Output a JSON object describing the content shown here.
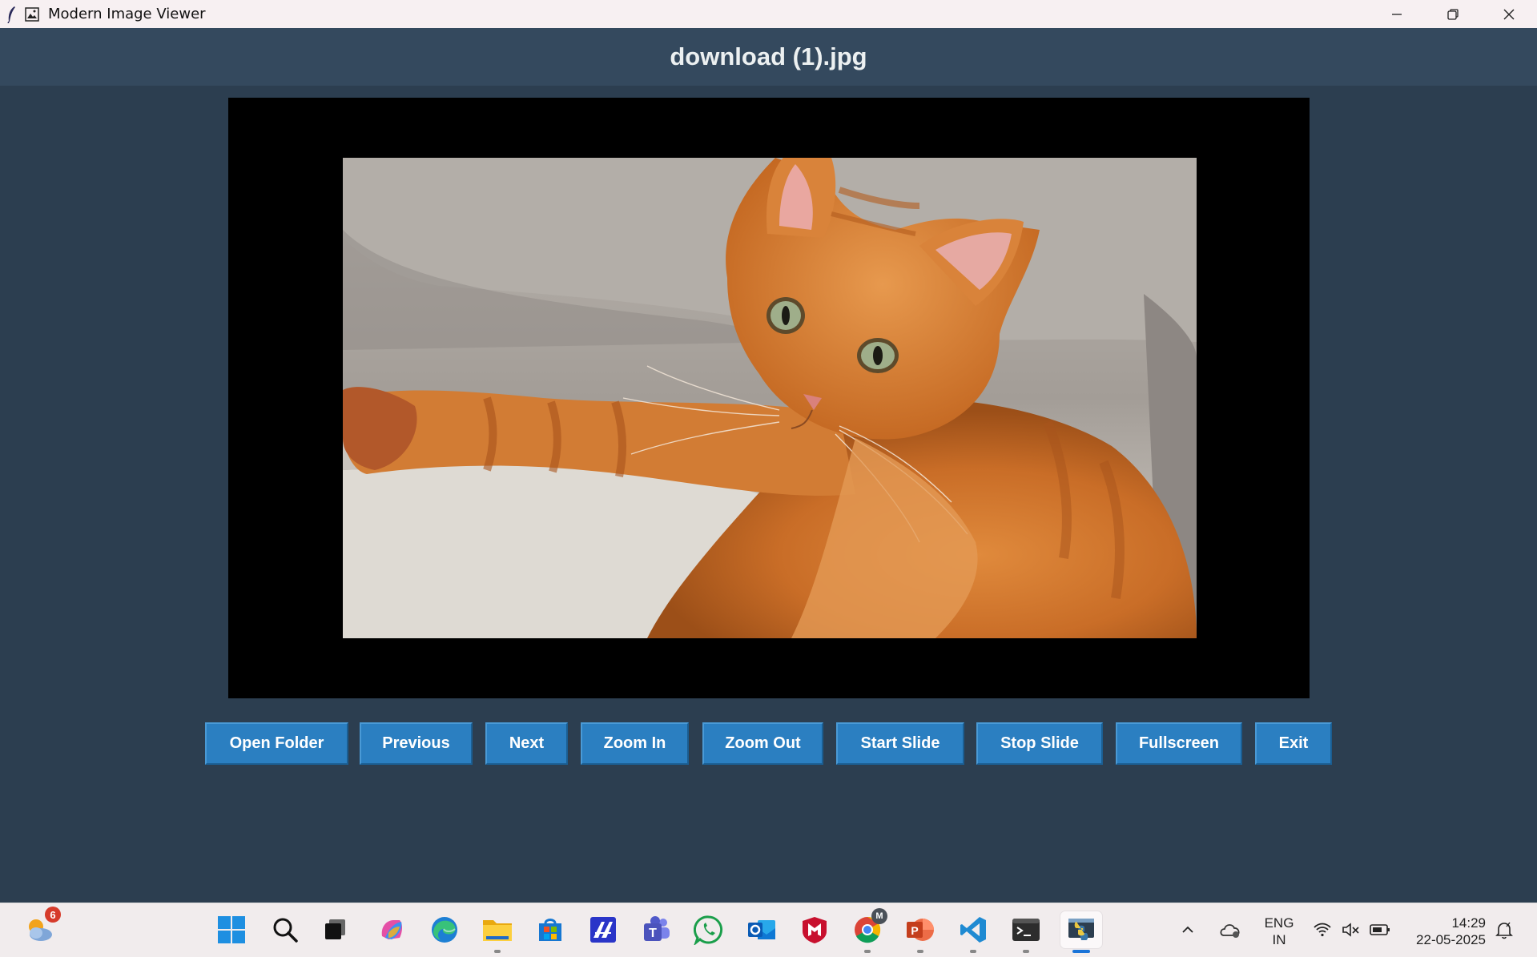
{
  "window": {
    "title": "Modern Image Viewer",
    "controls": [
      "minimize",
      "restore",
      "close"
    ]
  },
  "header": {
    "filename": "download (1).jpg"
  },
  "viewer": {
    "image_alt": "Orange tabby cat lying on a grey sofa"
  },
  "buttons": [
    {
      "label": "Open Folder"
    },
    {
      "label": "Previous"
    },
    {
      "label": "Next"
    },
    {
      "label": "Zoom In"
    },
    {
      "label": "Zoom Out"
    },
    {
      "label": "Start Slide"
    },
    {
      "label": "Stop Slide"
    },
    {
      "label": "Fullscreen"
    },
    {
      "label": "Exit"
    }
  ],
  "taskbar": {
    "weather_badge": "6",
    "apps": [
      "start",
      "search",
      "task-view",
      "copilot",
      "edge",
      "file-explorer",
      "microsoft-store",
      "app-a",
      "teams",
      "whatsapp",
      "outlook",
      "mcafee",
      "chrome",
      "powerpoint",
      "vscode",
      "terminal",
      "python-image-viewer"
    ],
    "chrome_badge": "M",
    "language_line1": "ENG",
    "language_line2": "IN",
    "time": "14:29",
    "date": "22-05-2025"
  },
  "colors": {
    "background": "#2c3e50",
    "header": "#34495e",
    "button": "#2b7fc1",
    "viewer": "#000000"
  }
}
